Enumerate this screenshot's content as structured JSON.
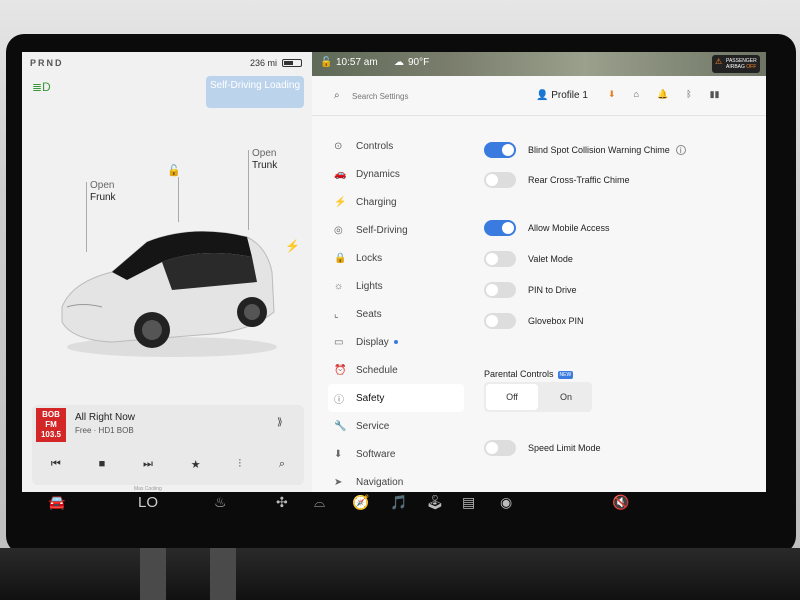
{
  "status": {
    "gear": "PRND",
    "range": "236 mi",
    "time": "10:57 am",
    "temp": "90°F",
    "battery_level": 0.55
  },
  "airbag": {
    "line1": "PASSENGER",
    "line2": "AIRBAG",
    "state": "OFF"
  },
  "left": {
    "self_driving": "Self-Driving Loading",
    "frunk": {
      "action": "Open",
      "name": "Frunk"
    },
    "trunk": {
      "action": "Open",
      "name": "Trunk"
    }
  },
  "media": {
    "logo": "BOB FM 103.5",
    "song": "All Right Now",
    "station": "Free · HD1 BOB"
  },
  "search": {
    "placeholder": "Search Settings"
  },
  "profile": {
    "label": "Profile 1"
  },
  "menu": [
    {
      "label": "Controls",
      "icon": "toggle-icon"
    },
    {
      "label": "Dynamics",
      "icon": "car-icon"
    },
    {
      "label": "Charging",
      "icon": "bolt-icon"
    },
    {
      "label": "Self-Driving",
      "icon": "steering-icon"
    },
    {
      "label": "Locks",
      "icon": "lock-icon"
    },
    {
      "label": "Lights",
      "icon": "sun-icon"
    },
    {
      "label": "Seats",
      "icon": "seat-icon"
    },
    {
      "label": "Display",
      "icon": "display-icon",
      "dot": true
    },
    {
      "label": "Schedule",
      "icon": "clock-icon"
    },
    {
      "label": "Safety",
      "icon": "alert-icon",
      "active": true
    },
    {
      "label": "Service",
      "icon": "wrench-icon"
    },
    {
      "label": "Software",
      "icon": "download-icon"
    },
    {
      "label": "Navigation",
      "icon": "nav-icon"
    }
  ],
  "safety": {
    "blind_spot": {
      "label": "Blind Spot Collision Warning Chime",
      "on": true
    },
    "rear_cross": {
      "label": "Rear Cross-Traffic Chime",
      "on": false
    },
    "mobile_access": {
      "label": "Allow Mobile Access",
      "on": true
    },
    "valet": {
      "label": "Valet Mode",
      "on": false
    },
    "pin_drive": {
      "label": "PIN to Drive",
      "on": false
    },
    "glovebox": {
      "label": "Glovebox PIN",
      "on": false
    },
    "parental": {
      "title": "Parental Controls",
      "badge": "NEW",
      "off": "Off",
      "on": "On",
      "selected": "Off"
    },
    "speed_limit": {
      "label": "Speed Limit Mode",
      "on": false
    }
  },
  "dock": {
    "climate_label": "Max Cooling",
    "climate_value": "LO"
  },
  "colors": {
    "accent": "#3a7be0",
    "badge": "#d32626",
    "warning": "#ff8a2a"
  }
}
